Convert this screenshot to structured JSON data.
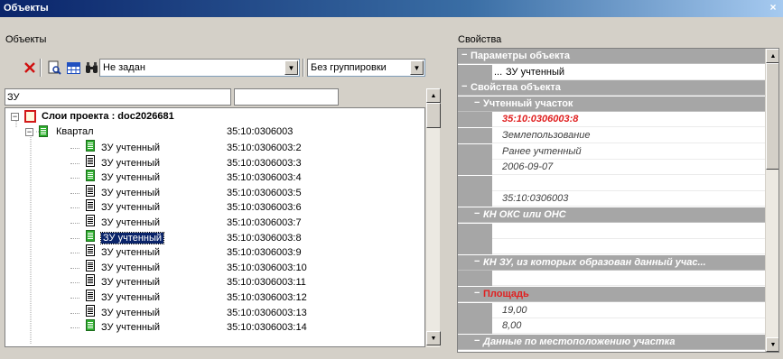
{
  "window": {
    "title": "Объекты",
    "close_glyph": "×"
  },
  "left": {
    "section_label": "Объекты",
    "filter_combo": {
      "value": "Не задан"
    },
    "group_combo": {
      "value": "Без группировки"
    },
    "filter_inputs": [
      {
        "value": "ЗУ"
      },
      {
        "value": ""
      }
    ],
    "tree": {
      "root": {
        "label": "Слои проекта : doc2026681"
      },
      "group": {
        "label": "Квартал",
        "code": "35:10:0306003"
      },
      "items": [
        {
          "label": "ЗУ учтенный",
          "code": "35:10:0306003:2",
          "icon": "green"
        },
        {
          "label": "ЗУ учтенный",
          "code": "35:10:0306003:3",
          "icon": "plain"
        },
        {
          "label": "ЗУ учтенный",
          "code": "35:10:0306003:4",
          "icon": "green"
        },
        {
          "label": "ЗУ учтенный",
          "code": "35:10:0306003:5",
          "icon": "plain"
        },
        {
          "label": "ЗУ учтенный",
          "code": "35:10:0306003:6",
          "icon": "plain"
        },
        {
          "label": "ЗУ учтенный",
          "code": "35:10:0306003:7",
          "icon": "plain"
        },
        {
          "label": "ЗУ учтенный",
          "code": "35:10:0306003:8",
          "icon": "green",
          "selected": true
        },
        {
          "label": "ЗУ учтенный",
          "code": "35:10:0306003:9",
          "icon": "plain"
        },
        {
          "label": "ЗУ учтенный",
          "code": "35:10:0306003:10",
          "icon": "plain"
        },
        {
          "label": "ЗУ учтенный",
          "code": "35:10:0306003:11",
          "icon": "plain"
        },
        {
          "label": "ЗУ учтенный",
          "code": "35:10:0306003:12",
          "icon": "plain"
        },
        {
          "label": "ЗУ учтенный",
          "code": "35:10:0306003:13",
          "icon": "plain"
        },
        {
          "label": "ЗУ учтенный",
          "code": "35:10:0306003:14",
          "icon": "green"
        }
      ]
    }
  },
  "right": {
    "section_label": "Свойства",
    "rows": [
      {
        "kind": "cat",
        "level": 0,
        "text": "Параметры объекта"
      },
      {
        "kind": "val",
        "text": "ЗУ учтенный",
        "ellipsis": "...",
        "style": "normal"
      },
      {
        "kind": "cat",
        "level": 0,
        "text": "Свойства объекта"
      },
      {
        "kind": "cat",
        "level": 1,
        "text": "Учтенный участок"
      },
      {
        "kind": "val",
        "text": "35:10:0306003:8",
        "style": "red"
      },
      {
        "kind": "val",
        "text": "Землепользование",
        "style": "italic"
      },
      {
        "kind": "val",
        "text": "Ранее учтенный",
        "style": "italic"
      },
      {
        "kind": "val",
        "text": "2006-09-07",
        "style": "italic"
      },
      {
        "kind": "val",
        "text": "",
        "style": "italic"
      },
      {
        "kind": "val",
        "text": "35:10:0306003",
        "style": "italic"
      },
      {
        "kind": "cat",
        "level": 1,
        "text": "КН ОКС или ОНС",
        "italic": true
      },
      {
        "kind": "val",
        "text": "",
        "style": "italic"
      },
      {
        "kind": "val",
        "text": "",
        "style": "italic"
      },
      {
        "kind": "cat",
        "level": 1,
        "text": "КН ЗУ, из которых образован данный учас...",
        "italic": true
      },
      {
        "kind": "val",
        "text": "",
        "style": "italic"
      },
      {
        "kind": "cat",
        "level": 1,
        "text": "Площадь",
        "red": true
      },
      {
        "kind": "val",
        "text": "19,00",
        "style": "italic"
      },
      {
        "kind": "val",
        "text": "8,00",
        "style": "italic"
      },
      {
        "kind": "cat",
        "level": 1,
        "text": "Данные по местоположению участка",
        "italic": true
      }
    ]
  },
  "colors": {
    "titlebar": "#0a246a",
    "category": "#a6a6a6",
    "required_red": "#e02020",
    "selection": "#0a246a"
  }
}
